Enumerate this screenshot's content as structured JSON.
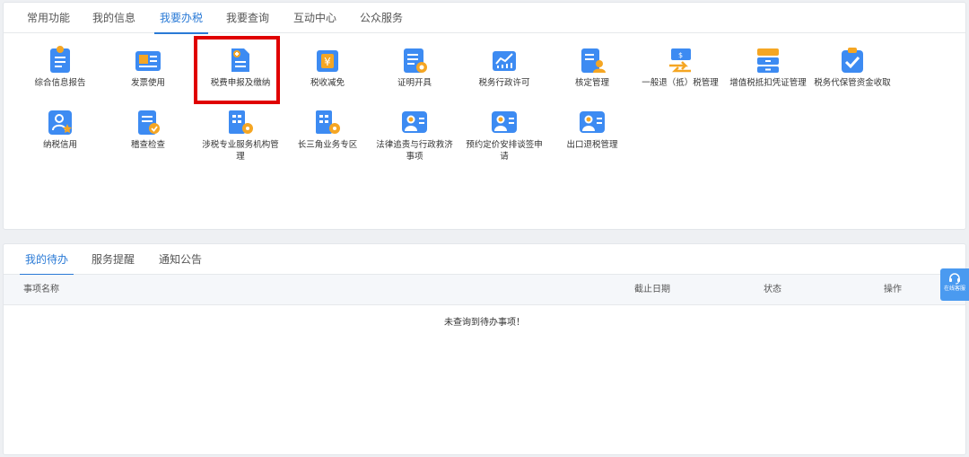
{
  "top_tabs": [
    "常用功能",
    "我的信息",
    "我要办税",
    "我要查询",
    "互动中心",
    "公众服务"
  ],
  "tiles": [
    {
      "label": "综合信息报告",
      "icon": "report-icon"
    },
    {
      "label": "发票使用",
      "icon": "invoice-icon"
    },
    {
      "label": "税费申报及缴纳",
      "icon": "tax-declaration-icon"
    },
    {
      "label": "税收减免",
      "icon": "tax-relief-icon"
    },
    {
      "label": "证明开具",
      "icon": "certificate-icon"
    },
    {
      "label": "税务行政许可",
      "icon": "admin-license-icon"
    },
    {
      "label": "核定管理",
      "icon": "assessment-icon"
    },
    {
      "label": "一般退（抵）税管理",
      "icon": "refund-icon"
    },
    {
      "label": "增值税抵扣凭证管理",
      "icon": "vat-deduction-icon"
    },
    {
      "label": "税务代保管资金收取",
      "icon": "custody-fund-icon"
    },
    {
      "label": "纳税信用",
      "icon": "tax-credit-icon"
    },
    {
      "label": "稽查检查",
      "icon": "inspection-icon"
    },
    {
      "label": "涉税专业服务机构管理",
      "icon": "agency-management-icon"
    },
    {
      "label": "长三角业务专区",
      "icon": "yangtze-delta-icon"
    },
    {
      "label": "法律追责与行政救济事项",
      "icon": "legal-remedy-icon"
    },
    {
      "label": "预约定价安排谈签申请",
      "icon": "pricing-arrangement-icon"
    },
    {
      "label": "出口退税管理",
      "icon": "export-refund-icon"
    }
  ],
  "bottom_tabs": [
    "我的待办",
    "服务提醒",
    "通知公告"
  ],
  "table": {
    "columns": [
      "事项名称",
      "截止日期",
      "状态",
      "操作"
    ],
    "empty_message": "未查询到待办事项！"
  },
  "float_service": {
    "label": "在线客服",
    "icon": "headset-icon"
  },
  "colors": {
    "accent": "#2a7ad6",
    "icon_blue": "#3d8bf2",
    "icon_orange": "#f5a623",
    "highlight": "#e00000"
  }
}
